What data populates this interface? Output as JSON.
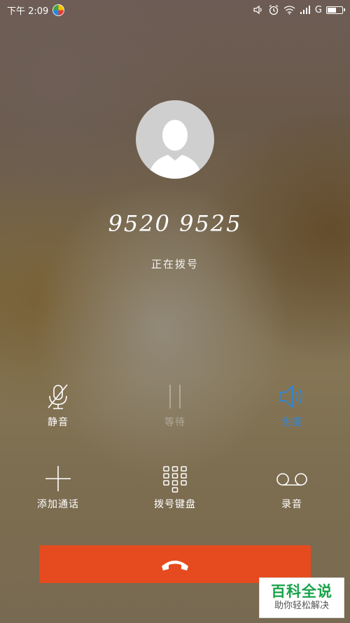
{
  "status_bar": {
    "time": "下午 2:09",
    "network": "G"
  },
  "call": {
    "number": "9520 9525",
    "status": "正在拨号"
  },
  "controls": {
    "mute": "静音",
    "hold": "等待",
    "speaker": "免提",
    "add_call": "添加通话",
    "dialpad": "拨号键盘",
    "record": "录音"
  },
  "colors": {
    "end_call": "#e54b1f",
    "speaker_active": "#2f86d8"
  },
  "watermark": {
    "main": "百科全说",
    "sub": "助你轻松解决"
  }
}
